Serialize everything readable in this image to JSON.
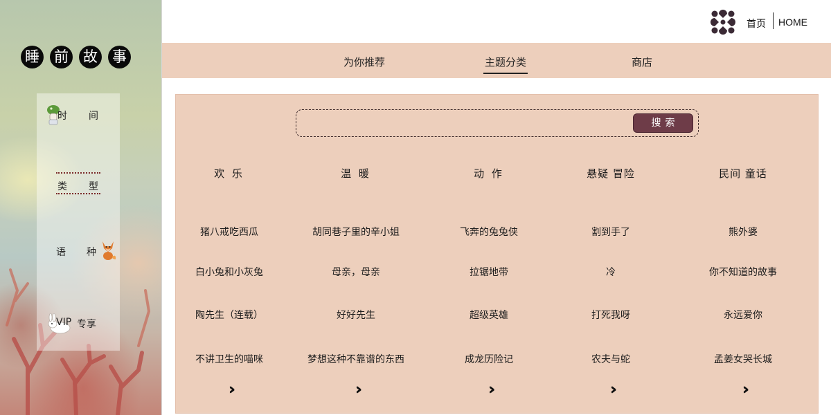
{
  "app": {
    "title_chars": [
      "睡",
      "前",
      "故",
      "事"
    ]
  },
  "sidebar": {
    "items": [
      {
        "label_a": "时",
        "label_b": "间",
        "icon": "mushroom-kid-icon"
      },
      {
        "label_a": "类",
        "label_b": "型",
        "icon": null
      },
      {
        "label_a": "语",
        "label_b": "种",
        "icon": "fox-icon"
      },
      {
        "label_a": "VIP",
        "label_b": "专享",
        "icon": "bunny-icon"
      }
    ]
  },
  "header": {
    "home_cn": "首页",
    "home_en": "HOME",
    "logo_icon": "flower-logo-icon"
  },
  "nav": {
    "tabs": [
      {
        "label": "为你推荐",
        "active": false
      },
      {
        "label": "主题分类",
        "active": true
      },
      {
        "label": "商店",
        "active": false
      }
    ]
  },
  "search": {
    "placeholder": "",
    "button_label": "搜索"
  },
  "categories": [
    {
      "title": "欢 乐",
      "stories": [
        "猪八戒吃西瓜",
        "白小兔和小灰兔",
        "陶先生（连载）",
        "不讲卫生的喵咪"
      ],
      "more": "»"
    },
    {
      "title": "温 暖",
      "stories": [
        "胡同巷子里的辛小姐",
        "母亲，母亲",
        "好好先生",
        "梦想这种不靠谱的东西"
      ],
      "more": "»"
    },
    {
      "title": "动 作",
      "stories": [
        "飞奔的兔兔侠",
        "拉锯地带",
        "超级英雄",
        "成龙历险记"
      ],
      "more": "»"
    },
    {
      "title": "悬疑 冒险",
      "stories": [
        "割到手了",
        "冷",
        "打死我呀",
        "农夫与蛇"
      ],
      "more": "»"
    },
    {
      "title": "民间 童话",
      "stories": [
        "熊外婆",
        "你不知道的故事",
        "永远爱你",
        "孟姜女哭长城"
      ],
      "more": "»"
    }
  ],
  "colors": {
    "panel": "#edcfbc",
    "button": "#6e3c48"
  }
}
